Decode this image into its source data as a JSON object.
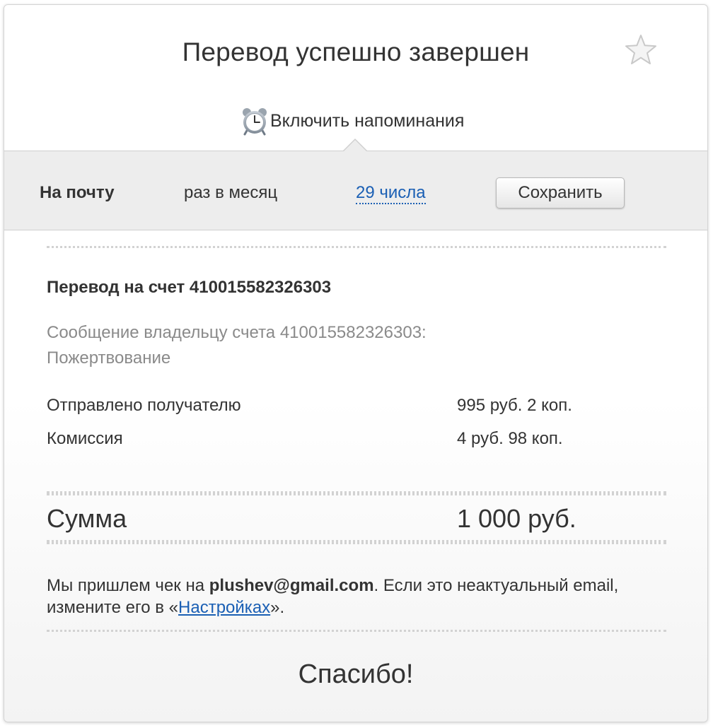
{
  "header": {
    "title": "Перевод успешно завершен",
    "favorite_icon": "star-icon"
  },
  "reminder": {
    "icon": "alarm-clock-icon",
    "label": "Включить напоминания",
    "channel": "На почту",
    "frequency": "раз в месяц",
    "day": "29 числа",
    "save_label": "Сохранить"
  },
  "transfer": {
    "title": "Перевод на счет 410015582326303",
    "message_line1": "Сообщение владельцу счета 410015582326303:",
    "message_line2": "Пожертвование",
    "rows": [
      {
        "label": "Отправлено получателю",
        "value": "995 руб. 2 коп."
      },
      {
        "label": "Комиссия",
        "value": "4 руб. 98 коп."
      }
    ],
    "total_label": "Сумма",
    "total_value": "1 000 руб."
  },
  "receipt_note": {
    "prefix": "Мы пришлем чек на ",
    "email": "plushev@gmail.com",
    "middle": ". Если это неактуальный email,",
    "line2_prefix": "измените его в «",
    "settings_link": "Настройках",
    "line2_suffix": "»."
  },
  "footer": {
    "thanks": "Спасибо!"
  },
  "colors": {
    "link": "#1a5fb4",
    "panel_bg": "#ededed",
    "muted_text": "#8a8a8a",
    "text": "#333333"
  }
}
